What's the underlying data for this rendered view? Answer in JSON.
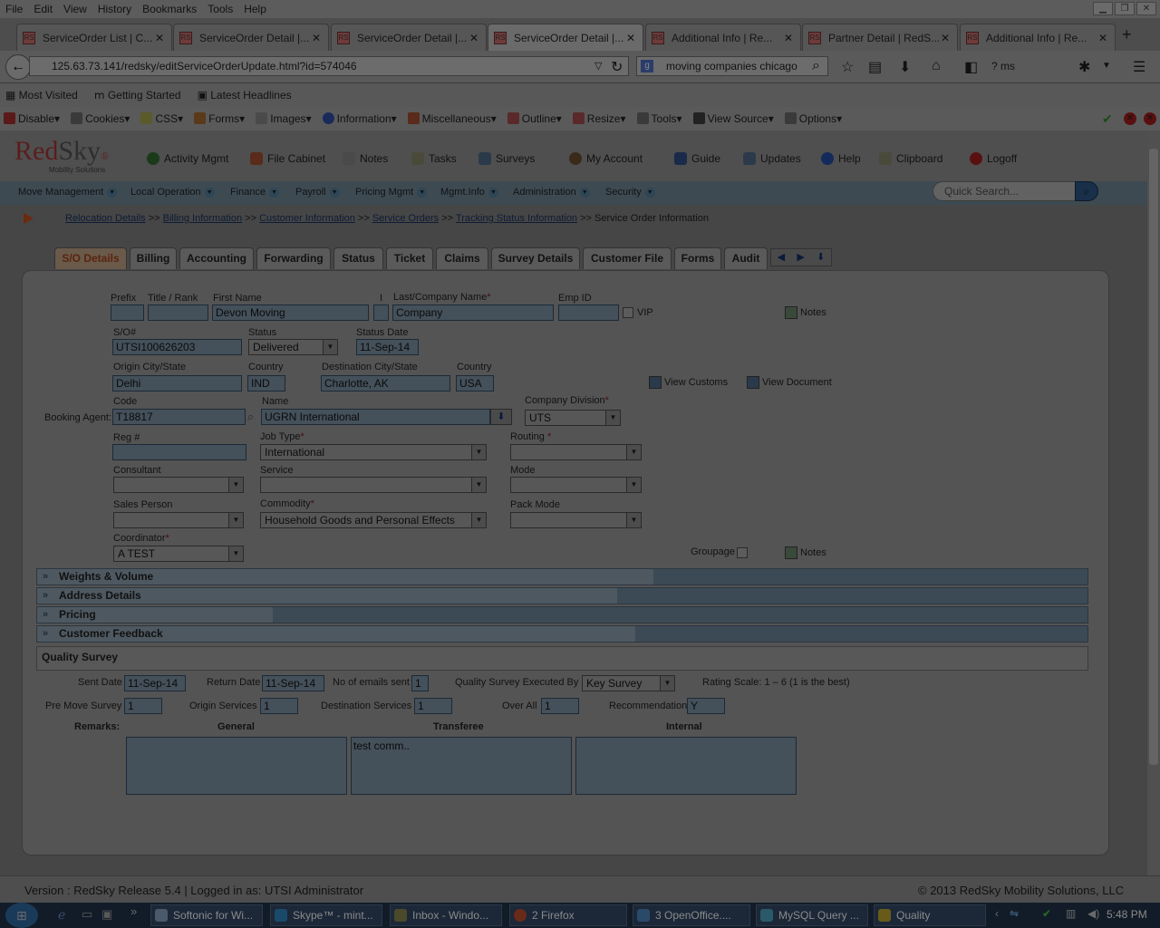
{
  "browser": {
    "menu": [
      "File",
      "Edit",
      "View",
      "History",
      "Bookmarks",
      "Tools",
      "Help"
    ],
    "tabs": [
      "ServiceOrder List | C...",
      "ServiceOrder Detail |...",
      "ServiceOrder Detail |...",
      "ServiceOrder Detail |...",
      "Additional Info | Re...",
      "Partner Detail | RedS...",
      "Additional Info | Re..."
    ],
    "favicon_text": "RS",
    "url": "125.63.73.141/redsky/editServiceOrderUpdate.html?id=574046",
    "search": "moving companies chicago",
    "search_engine": "g",
    "ms_label": "? ms",
    "bookmarks": [
      "Most Visited",
      "Getting Started",
      "Latest Headlines"
    ],
    "devbar": [
      "Disable",
      "Cookies",
      "CSS",
      "Forms",
      "Images",
      "Information",
      "Miscellaneous",
      "Outline",
      "Resize",
      "Tools",
      "View Source",
      "Options"
    ]
  },
  "app": {
    "logo_red": "Red",
    "logo_sky": "Sky",
    "logo_sub": "Mobility Solutions",
    "logo_reg": "®",
    "header_items": [
      "Activity Mgmt",
      "File Cabinet",
      "Notes",
      "Tasks",
      "Surveys",
      "My Account",
      "Guide",
      "Updates",
      "Help",
      "Clipboard",
      "Logoff"
    ],
    "main_menu": [
      "Move Management",
      "Local Operation",
      "Finance",
      "Payroll",
      "Pricing Mgmt",
      "Mgmt.Info",
      "Administration",
      "Security"
    ],
    "quick_search_placeholder": "Quick Search...",
    "breadcrumbs": [
      "Relocation Details",
      "Billing Information",
      "Customer Information",
      "Service Orders",
      "Tracking Status Information"
    ],
    "breadcrumb_current": "Service Order Information",
    "breadcrumb_sep": ">>",
    "page_tabs": [
      "S/O Details",
      "Billing",
      "Accounting",
      "Forwarding",
      "Status",
      "Ticket",
      "Claims",
      "Survey Details",
      "Customer File",
      "Forms",
      "Audit"
    ]
  },
  "form": {
    "labels": {
      "prefix": "Prefix",
      "title": "Title / Rank",
      "first": "First Name",
      "initial": "I",
      "last": "Last/Company Name",
      "empid": "Emp ID",
      "vip": "VIP",
      "so": "S/O#",
      "status": "Status",
      "status_date": "Status Date",
      "origin": "Origin City/State",
      "country": "Country",
      "dest": "Destination City/State",
      "country2": "Country",
      "code": "Code",
      "name": "Name",
      "company_div": "Company Division",
      "booking_agent": "Booking Agent:",
      "reg": "Reg #",
      "job_type": "Job Type",
      "routing": "Routing",
      "consultant": "Consultant",
      "service": "Service",
      "mode": "Mode",
      "sales_person": "Sales Person",
      "commodity": "Commodity",
      "pack_mode": "Pack Mode",
      "coordinator": "Coordinator",
      "groupage": "Groupage",
      "notes": "Notes",
      "view_customs": "View Customs",
      "view_document": "View Document",
      "req": "*"
    },
    "values": {
      "prefix": "",
      "title": "",
      "first": "Devon Moving",
      "initial": "",
      "last": "Company",
      "empid": "",
      "so": "UTSI100626203",
      "status": "Delivered",
      "status_date": "11-Sep-14",
      "origin": "Delhi",
      "country": "IND",
      "dest": "Charlotte, AK",
      "country2": "USA",
      "code": "T18817",
      "name": "UGRN International",
      "company_div": "UTS",
      "reg": "",
      "job_type": "International",
      "routing": "",
      "consultant": "",
      "service": "",
      "mode": "",
      "sales_person": "",
      "commodity": "Household Goods and Personal Effects",
      "pack_mode": "",
      "coordinator": "A TEST"
    }
  },
  "sections": [
    "Weights & Volume",
    "Address Details",
    "Pricing",
    "Customer Feedback"
  ],
  "quality": {
    "title": "Quality Survey",
    "sent_date_label": "Sent Date",
    "sent_date": "11-Sep-14",
    "return_date_label": "Return Date",
    "return_date": "11-Sep-14",
    "emails_label": "No of emails sent",
    "emails": "1",
    "executed_label": "Quality Survey Executed By",
    "executed": "Key Survey",
    "rating_scale": "Rating Scale:  1 – 6 (1 is the best)",
    "pre_move_label": "Pre Move Survey",
    "pre_move": "1",
    "origin_label": "Origin Services",
    "origin": "1",
    "dest_label": "Destination Services",
    "dest": "1",
    "overall_label": "Over All",
    "overall": "1",
    "recommend_label": "Recommendation",
    "recommend": "Y",
    "remarks_label": "Remarks:",
    "general_label": "General",
    "general": "",
    "transferee_label": "Transferee",
    "transferee": "test comm..",
    "internal_label": "Internal",
    "internal": ""
  },
  "footer": {
    "left": "Version : RedSky Release 5.4 | Logged in as: UTSI Administrator",
    "right": "© 2013 RedSky Mobility Solutions, LLC"
  },
  "taskbar": {
    "items": [
      "Softonic for Wi...",
      "Skype™ - mint...",
      "Inbox - Windo...",
      "2 Firefox",
      "3 OpenOffice....",
      "MySQL Query ...",
      "Quality"
    ],
    "time": "5:48 PM"
  }
}
